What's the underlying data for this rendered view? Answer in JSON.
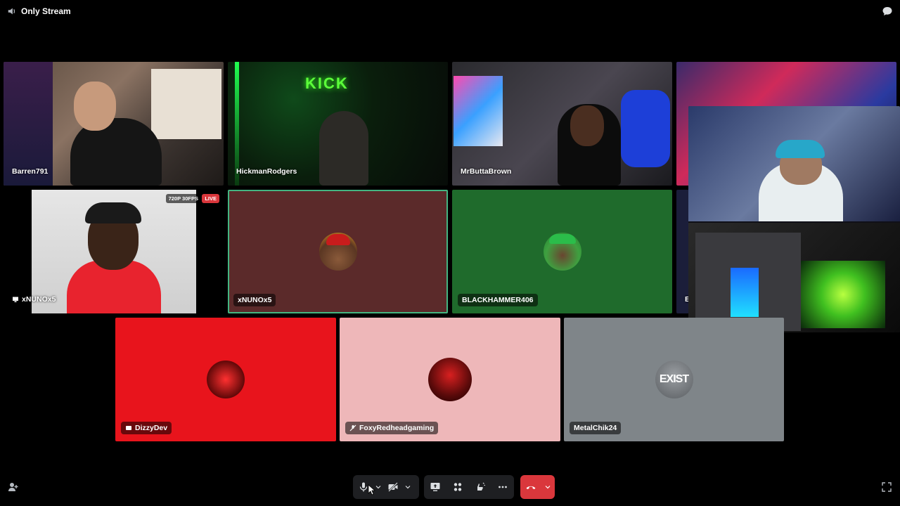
{
  "header": {
    "title": "Only Stream",
    "channel_icon": "speaker-icon",
    "chat_icon": "chat-bubble-icon"
  },
  "tiles": [
    {
      "name": "Barren791",
      "type": "video"
    },
    {
      "name": "HickmanRodgers",
      "type": "video"
    },
    {
      "name": "MrButtaBrown",
      "type": "video"
    },
    {
      "name": "xNUNOx5",
      "type": "stream",
      "quality": "720P 30FPS",
      "live": "LIVE",
      "tag_icon": "stream-screen-icon"
    },
    {
      "name": "xNUNOx5",
      "type": "avatar",
      "bg": "#5b2a2a",
      "speaking": true
    },
    {
      "name": "BLACKHAMMER406",
      "type": "avatar",
      "bg": "#1f6b2c"
    },
    {
      "name": "E",
      "type": "video-partial"
    },
    {
      "name": "DizzyDev",
      "type": "avatar",
      "bg": "#e8141c",
      "tag_icon": "stream-icon"
    },
    {
      "name": "FoxyRedheadgaming",
      "type": "avatar",
      "bg": "#eeb7b9",
      "tag_icon": "muted-mic-icon"
    },
    {
      "name": "MetalChik24",
      "type": "avatar",
      "bg": "#7f8589",
      "avatar_text": "EXIST"
    }
  ],
  "controls": {
    "mic": "microphone-icon",
    "camera": "camera-off-icon",
    "screen_share": "screen-share-icon",
    "activities": "activities-icon",
    "soundboard": "soundboard-icon",
    "more": "more-icon",
    "disconnect": "hang-up-icon",
    "disconnect_color": "#da373c",
    "invite": "add-user-icon",
    "fullscreen": "fullscreen-icon"
  }
}
